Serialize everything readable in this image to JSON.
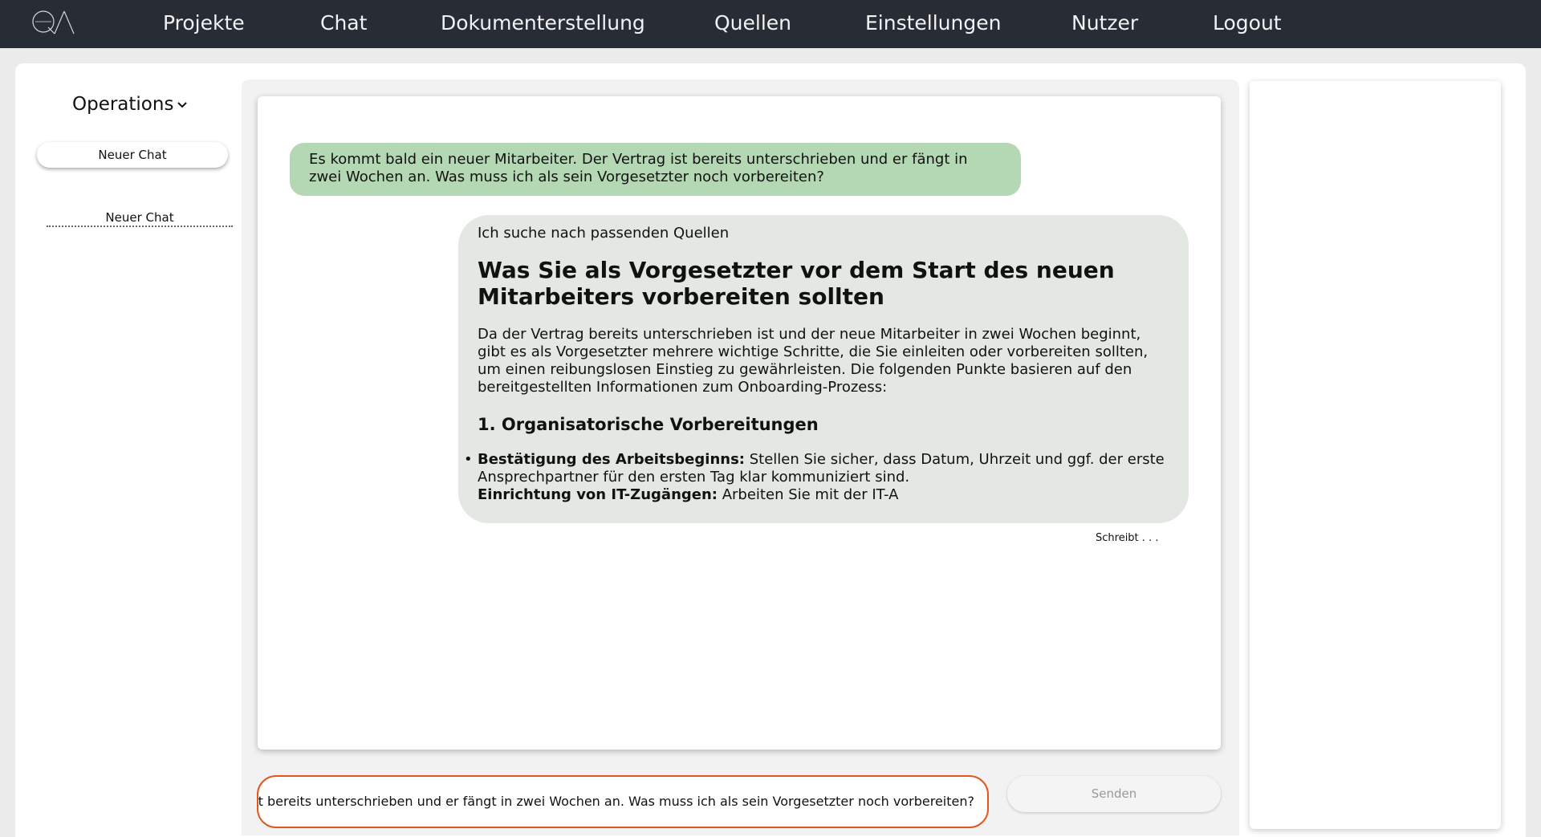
{
  "nav": {
    "logo_icon": "qa-logo-icon",
    "items": [
      {
        "label": "Projekte"
      },
      {
        "label": "Chat"
      },
      {
        "label": "Dokumenterstellung"
      },
      {
        "label": "Quellen"
      },
      {
        "label": "Einstellungen"
      },
      {
        "label": "Nutzer"
      },
      {
        "label": "Logout"
      }
    ]
  },
  "sidebar": {
    "project": "Operations",
    "project_icon": "chevron-down-icon",
    "new_chat_label": "Neuer Chat",
    "chats": [
      {
        "label": "Neuer Chat"
      }
    ]
  },
  "chat": {
    "user_message": "Es kommt bald ein neuer Mitarbeiter. Der Vertrag ist bereits unterschrieben und er fängt in zwei Wochen an. Was muss ich als sein Vorgesetzter noch vorbereiten?",
    "bot": {
      "status": "Ich suche nach passenden Quellen",
      "heading": "Was Sie als Vorgesetzter vor dem Start des neuen Mitarbeiters vorbereiten sollten",
      "paragraph": "Da der Vertrag bereits unterschrieben ist und der neue Mitarbeiter in zwei Wochen beginnt, gibt es als Vorgesetzter mehrere wichtige Schritte, die Sie einleiten oder vorbereiten sollten, um einen reibungslosen Einstieg zu gewährleisten. Die folgenden Punkte basieren auf den bereitgestellten Informationen zum Onboarding-Prozess:",
      "subheading": "1. Organisatorische Vorbereitungen",
      "items": [
        {
          "bold": "Bestätigung des Arbeitsbeginns:",
          "text": " Stellen Sie sicher, dass Datum, Uhrzeit und ggf. der erste Ansprechpartner für den ersten Tag klar kommuniziert sind."
        },
        {
          "bold": "Einrichtung von IT-Zugängen:",
          "text": " Arbeiten Sie mit der IT-A"
        }
      ]
    },
    "typing_indicator": "Schreibt . . ."
  },
  "input": {
    "value": "Es kommt bald ein neuer Mitarbeiter. Der Vertrag ist bereits unterschrieben und er fängt in zwei Wochen an. Was muss ich als sein Vorgesetzter noch vorbereiten?",
    "send_label": "Senden"
  },
  "colors": {
    "nav_bg": "#272c35",
    "user_bubble": "#b5d8b4",
    "bot_bubble": "#e3e8e2",
    "input_border": "#e0571e"
  }
}
